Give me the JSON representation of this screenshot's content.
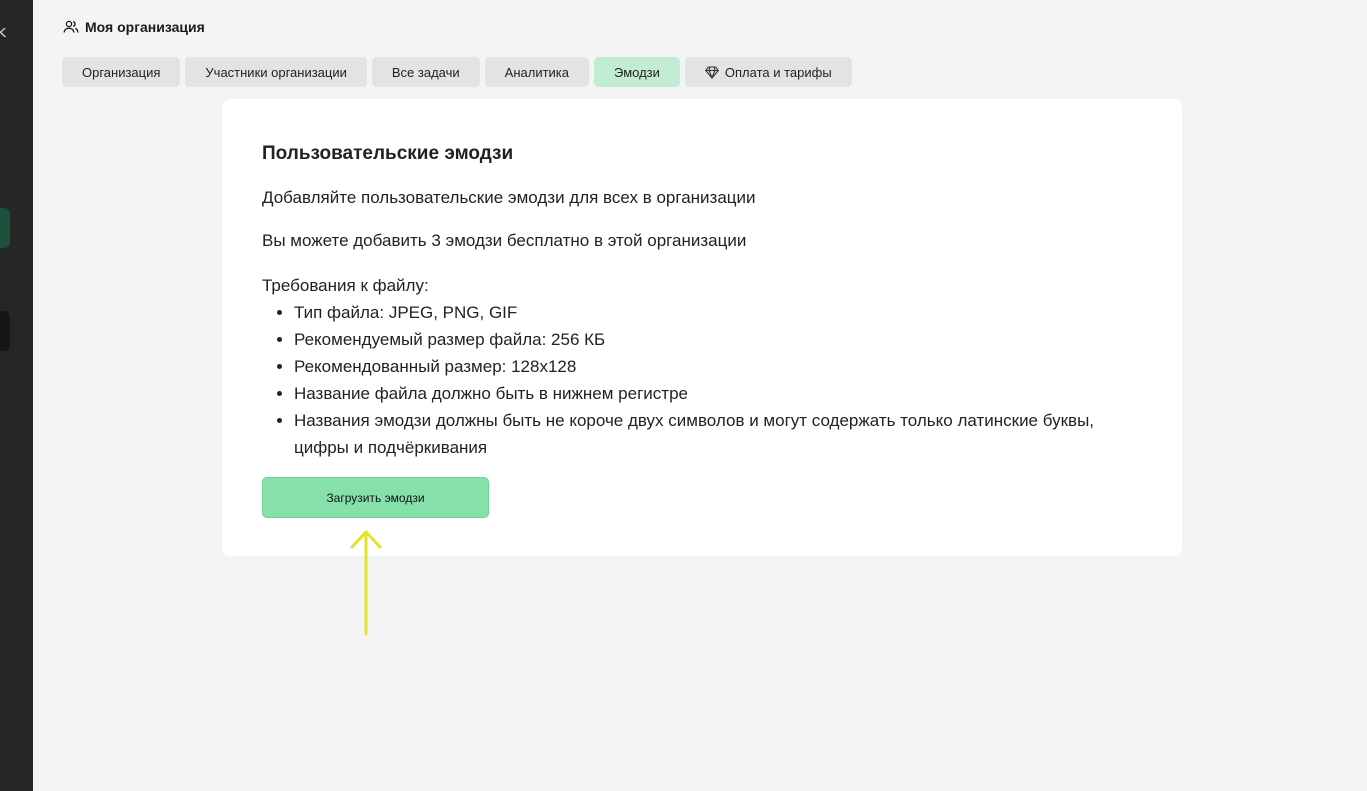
{
  "sidebar": {
    "edge_glyph": "k"
  },
  "header": {
    "icon": "users-icon",
    "title": "Моя организация"
  },
  "tabs": [
    {
      "label": "Организация",
      "active": false
    },
    {
      "label": "Участники организации",
      "active": false
    },
    {
      "label": "Все задачи",
      "active": false
    },
    {
      "label": "Аналитика",
      "active": false
    },
    {
      "label": "Эмодзи",
      "active": true
    },
    {
      "label": "Оплата и тарифы",
      "active": false,
      "icon": "diamond-icon"
    }
  ],
  "card": {
    "title": "Пользовательские эмодзи",
    "description": "Добавляйте пользовательские эмодзи для всех в организации",
    "limit_text": "Вы можете добавить 3 эмодзи бесплатно в этой организации",
    "requirements_title": "Требования к файлу:",
    "requirements": [
      "Тип файла: JPEG, PNG, GIF",
      "Рекомендуемый размер файла: 256 КБ",
      "Рекомендованный размер: 128x128",
      "Название файла должно быть в нижнем регистре",
      "Названия эмодзи должны быть не короче двух символов и могут содержать только латинские буквы, цифры и подчёркивания"
    ],
    "upload_label": "Загрузить эмодзи"
  },
  "colors": {
    "sidebar_bg": "#262626",
    "page_bg": "#f4f4f4",
    "active_tab": "#c2ecd4",
    "button_bg": "#86e0aa",
    "annotation_arrow": "#e6e22a"
  }
}
